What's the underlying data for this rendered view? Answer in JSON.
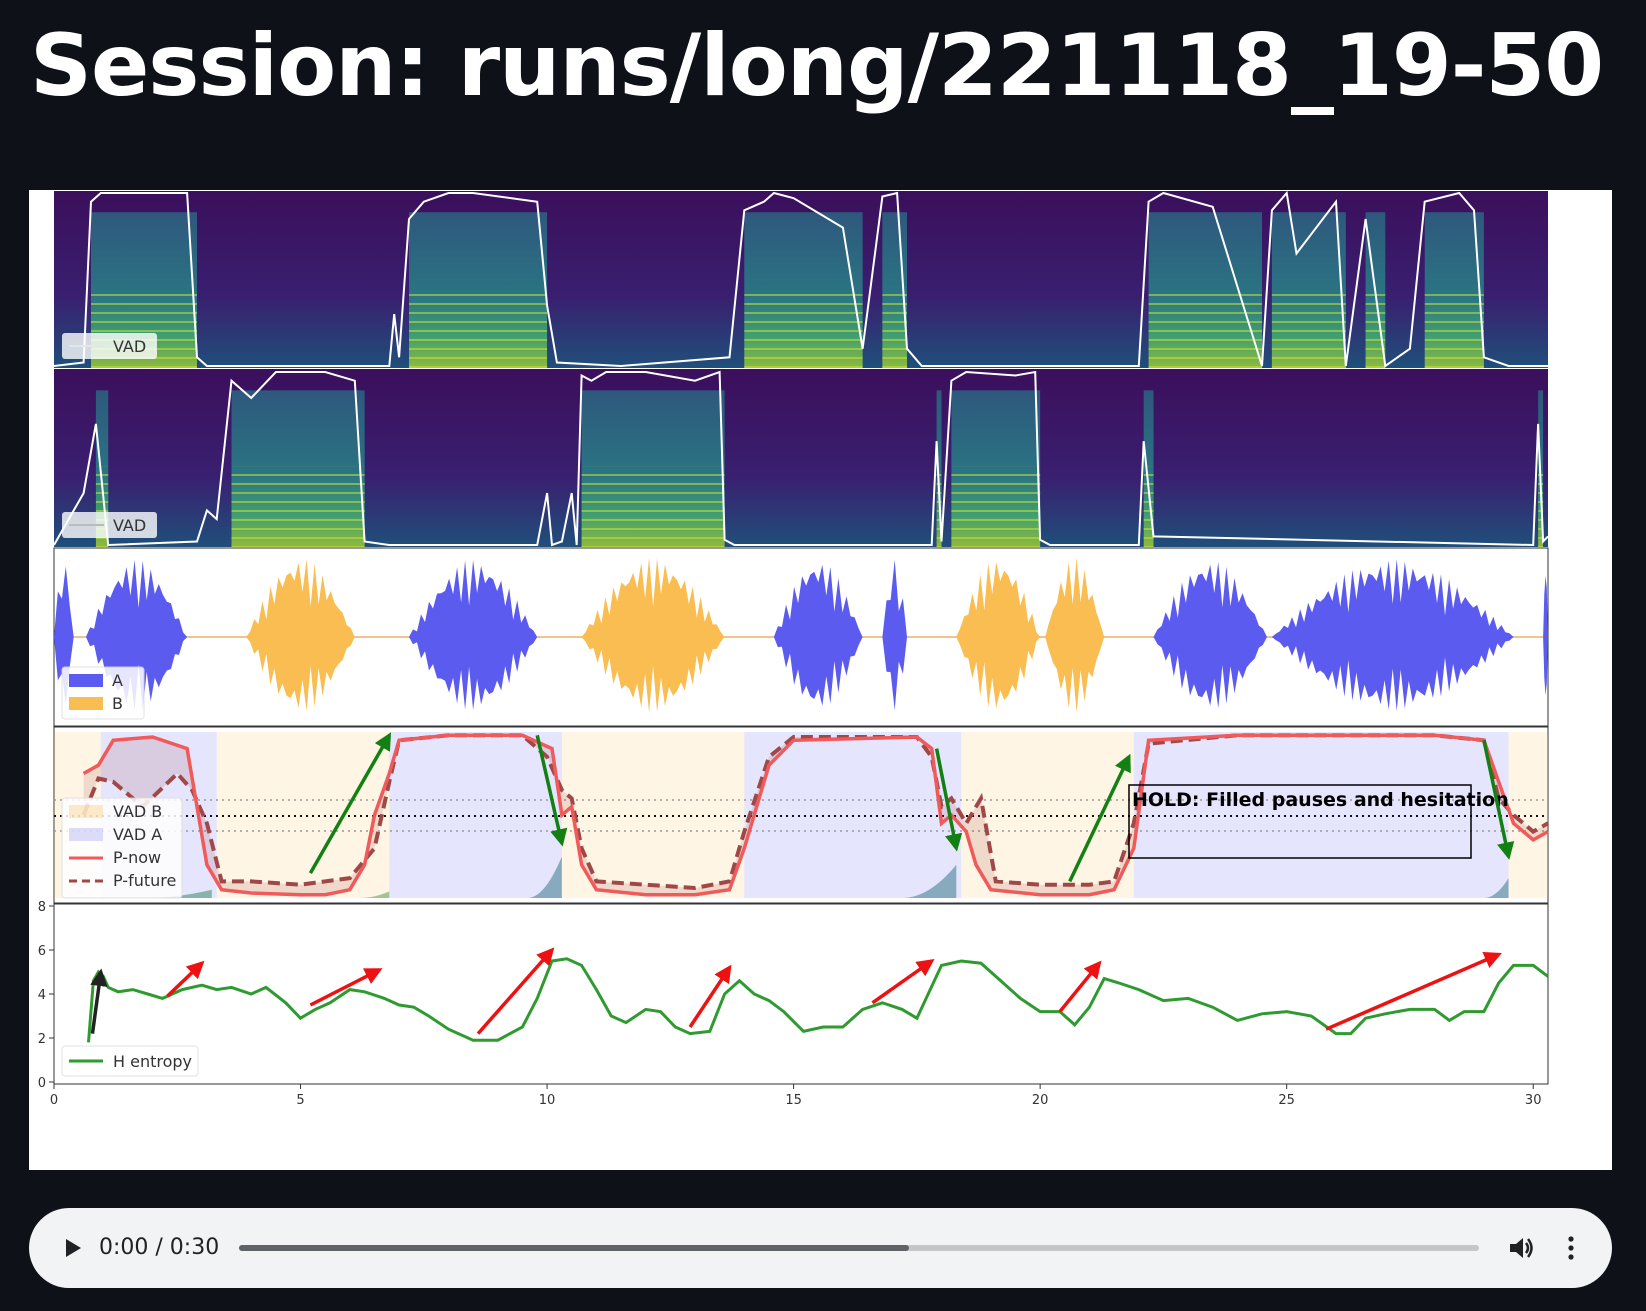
{
  "page": {
    "title": "Session: runs/long/221118_19-50"
  },
  "player": {
    "time": "0:00 / 0:30",
    "progress": 0.54,
    "icons": [
      "play-icon",
      "volume-icon",
      "more-vert-icon"
    ]
  },
  "colors": {
    "background": "#0e1117",
    "speaker_a": "#5b5bf0",
    "speaker_b": "#f9bd52",
    "p_now": "#f05a5a",
    "p_future": "#a04848",
    "entropy": "#2f9a2f",
    "arrow_green": "#128012",
    "arrow_red": "#ee1111"
  },
  "chart_data": [
    {
      "type": "line",
      "panel": "spectrogram A",
      "legend": [
        "VAD"
      ],
      "series": [
        {
          "name": "VAD",
          "x": [
            0.0,
            0.6,
            0.75,
            0.95,
            2.7,
            2.9,
            3.1,
            6.8,
            6.9,
            7.0,
            7.2,
            7.5,
            8.0,
            8.5,
            9.8,
            10.0,
            10.2,
            11.5,
            13.7,
            14.0,
            14.4,
            14.6,
            15.0,
            16.0,
            16.4,
            16.8,
            17.1,
            17.3,
            17.6,
            18.0,
            18.3,
            22.0,
            22.2,
            22.5,
            23.5,
            24.5,
            24.7,
            25.0,
            25.2,
            26.0,
            26.2,
            26.6,
            27.0,
            27.5,
            27.8,
            28.5,
            28.8,
            29.0,
            29.5,
            30.3
          ],
          "y": [
            0.0,
            0.02,
            0.95,
            1.0,
            1.0,
            0.05,
            0.0,
            0.0,
            0.3,
            0.05,
            0.85,
            0.95,
            1.0,
            1.0,
            0.95,
            0.35,
            0.02,
            0.0,
            0.05,
            0.9,
            0.95,
            1.0,
            0.97,
            0.8,
            0.1,
            0.98,
            1.0,
            0.1,
            0.0,
            0.0,
            0.0,
            0.0,
            0.95,
            1.0,
            0.92,
            0.0,
            0.9,
            1.0,
            0.65,
            0.95,
            0.0,
            0.85,
            0.0,
            0.1,
            0.95,
            1.0,
            0.9,
            0.05,
            0.0,
            0.0
          ]
        }
      ]
    },
    {
      "type": "line",
      "panel": "spectrogram B",
      "legend": [
        "VAD"
      ],
      "series": [
        {
          "name": "VAD",
          "x": [
            0.0,
            0.6,
            0.85,
            1.1,
            2.9,
            3.1,
            3.3,
            3.6,
            4.0,
            4.5,
            5.5,
            6.1,
            6.3,
            6.8,
            9.8,
            10.0,
            10.1,
            10.3,
            10.5,
            10.6,
            10.7,
            10.9,
            11.2,
            12.0,
            13.0,
            13.5,
            13.6,
            13.8,
            17.8,
            17.9,
            18.0,
            18.2,
            18.5,
            19.5,
            19.9,
            20.0,
            20.2,
            22.0,
            22.1,
            22.3,
            30.0,
            30.1,
            30.2,
            30.3
          ],
          "y": [
            0.0,
            0.3,
            0.7,
            0.0,
            0.02,
            0.2,
            0.15,
            0.95,
            0.85,
            1.0,
            1.0,
            0.95,
            0.02,
            0.0,
            0.0,
            0.3,
            0.0,
            0.02,
            0.3,
            0.0,
            0.98,
            0.95,
            1.0,
            1.0,
            0.95,
            1.0,
            0.03,
            0.0,
            0.0,
            0.6,
            0.02,
            0.95,
            1.0,
            0.98,
            1.0,
            0.03,
            0.0,
            0.0,
            0.6,
            0.05,
            0.0,
            0.7,
            0.02,
            0.05
          ]
        }
      ]
    },
    {
      "type": "area",
      "panel": "waveform",
      "legend": [
        "A",
        "B"
      ],
      "series": [
        {
          "name": "A",
          "segments": [
            [
              0.0,
              0.4
            ],
            [
              0.65,
              2.7
            ],
            [
              7.2,
              9.8
            ],
            [
              14.6,
              16.4
            ],
            [
              16.8,
              17.3
            ],
            [
              22.3,
              24.6
            ],
            [
              24.7,
              29.6
            ],
            [
              30.2,
              30.3
            ]
          ]
        },
        {
          "name": "B",
          "segments": [
            [
              3.9,
              6.1
            ],
            [
              10.7,
              13.6
            ],
            [
              18.3,
              20.0
            ],
            [
              20.1,
              21.3
            ]
          ]
        }
      ]
    },
    {
      "type": "line",
      "panel": "turn-shift probability",
      "legend": [
        "VAD B",
        "VAD A",
        "P-now",
        "P-future"
      ],
      "series": [
        {
          "name": "P-now",
          "x": [
            0.6,
            0.9,
            1.2,
            2.0,
            2.7,
            3.1,
            3.4,
            4.0,
            5.0,
            5.5,
            6.0,
            6.3,
            6.5,
            6.8,
            7.0,
            8.0,
            9.5,
            10.1,
            10.3,
            10.5,
            10.7,
            11.0,
            12.0,
            13.0,
            13.7,
            14.0,
            14.5,
            15.0,
            17.5,
            17.8,
            18.0,
            18.2,
            18.5,
            18.7,
            19.0,
            20.0,
            21.0,
            21.5,
            21.9,
            22.2,
            24.0,
            28.0,
            29.0,
            29.3,
            29.6,
            30.0,
            30.3
          ],
          "y": [
            0.75,
            0.8,
            0.95,
            0.97,
            0.9,
            0.2,
            0.05,
            0.03,
            0.02,
            0.02,
            0.05,
            0.2,
            0.5,
            0.75,
            0.95,
            0.98,
            0.98,
            0.9,
            0.5,
            0.55,
            0.2,
            0.05,
            0.02,
            0.02,
            0.05,
            0.3,
            0.8,
            0.95,
            0.97,
            0.9,
            0.45,
            0.5,
            0.4,
            0.2,
            0.05,
            0.02,
            0.02,
            0.05,
            0.3,
            0.95,
            0.98,
            0.98,
            0.95,
            0.7,
            0.45,
            0.35,
            0.4
          ]
        },
        {
          "name": "P-future",
          "x": [
            0.6,
            0.9,
            1.2,
            1.8,
            2.5,
            2.8,
            3.1,
            3.4,
            4.0,
            5.0,
            6.0,
            6.5,
            6.8,
            7.0,
            8.0,
            9.5,
            10.0,
            10.3,
            10.5,
            10.7,
            11.0,
            12.0,
            13.0,
            13.7,
            14.0,
            14.5,
            15.0,
            17.5,
            17.8,
            18.0,
            18.2,
            18.5,
            18.8,
            19.1,
            20.0,
            21.0,
            21.5,
            21.9,
            22.2,
            24.0,
            28.0,
            29.0,
            29.3,
            29.6,
            30.0,
            30.3
          ],
          "y": [
            0.5,
            0.72,
            0.7,
            0.55,
            0.75,
            0.65,
            0.45,
            0.1,
            0.1,
            0.08,
            0.12,
            0.3,
            0.7,
            0.95,
            0.98,
            0.98,
            0.85,
            0.65,
            0.6,
            0.3,
            0.1,
            0.08,
            0.06,
            0.1,
            0.4,
            0.85,
            0.97,
            0.97,
            0.85,
            0.55,
            0.6,
            0.45,
            0.6,
            0.1,
            0.08,
            0.08,
            0.1,
            0.45,
            0.93,
            0.98,
            0.98,
            0.95,
            0.6,
            0.5,
            0.4,
            0.45
          ]
        }
      ],
      "annotations": [
        "HOLD: Filled pauses and hesitation"
      ]
    },
    {
      "type": "line",
      "panel": "entropy",
      "legend": [
        "H entropy"
      ],
      "xticks": [
        0,
        5,
        10,
        15,
        20,
        25,
        30
      ],
      "yticks": [
        0,
        2,
        4,
        6,
        8
      ],
      "xlim": [
        0,
        30.3
      ],
      "ylim": [
        0,
        8
      ],
      "series": [
        {
          "name": "H entropy",
          "x": [
            0.7,
            0.8,
            0.9,
            1.0,
            1.1,
            1.3,
            1.6,
            1.9,
            2.2,
            2.6,
            3.0,
            3.3,
            3.6,
            4.0,
            4.3,
            4.7,
            5.0,
            5.3,
            5.6,
            6.0,
            6.3,
            6.7,
            7.0,
            7.3,
            7.6,
            8.0,
            8.5,
            9.0,
            9.5,
            9.8,
            10.1,
            10.4,
            10.7,
            11.0,
            11.3,
            11.6,
            12.0,
            12.3,
            12.6,
            12.9,
            13.3,
            13.6,
            13.9,
            14.2,
            14.5,
            14.8,
            15.2,
            15.6,
            16.0,
            16.4,
            16.8,
            17.2,
            17.5,
            18.0,
            18.4,
            18.8,
            19.2,
            19.6,
            20.0,
            20.4,
            20.7,
            21.0,
            21.3,
            21.6,
            22.0,
            22.5,
            23.0,
            23.5,
            24.0,
            24.5,
            25.0,
            25.5,
            26.0,
            26.3,
            26.6,
            27.0,
            27.5,
            28.0,
            28.3,
            28.6,
            29.0,
            29.3,
            29.6,
            30.0,
            30.3
          ],
          "y": [
            1.8,
            4.6,
            5.0,
            4.8,
            4.3,
            4.1,
            4.2,
            4.0,
            3.8,
            4.2,
            4.4,
            4.2,
            4.3,
            4.0,
            4.3,
            3.6,
            2.9,
            3.3,
            3.6,
            4.2,
            4.1,
            3.8,
            3.5,
            3.4,
            3.0,
            2.4,
            1.9,
            1.9,
            2.5,
            3.8,
            5.5,
            5.6,
            5.3,
            4.2,
            3.0,
            2.7,
            3.3,
            3.2,
            2.5,
            2.2,
            2.3,
            4.0,
            4.6,
            4.0,
            3.7,
            3.2,
            2.3,
            2.5,
            2.5,
            3.3,
            3.6,
            3.3,
            2.9,
            5.3,
            5.5,
            5.4,
            4.6,
            3.8,
            3.2,
            3.2,
            2.6,
            3.4,
            4.7,
            4.5,
            4.2,
            3.7,
            3.8,
            3.4,
            2.8,
            3.1,
            3.2,
            3.0,
            2.2,
            2.2,
            2.9,
            3.1,
            3.3,
            3.3,
            2.8,
            3.2,
            3.2,
            4.5,
            5.3,
            5.3,
            4.8
          ]
        }
      ]
    }
  ]
}
